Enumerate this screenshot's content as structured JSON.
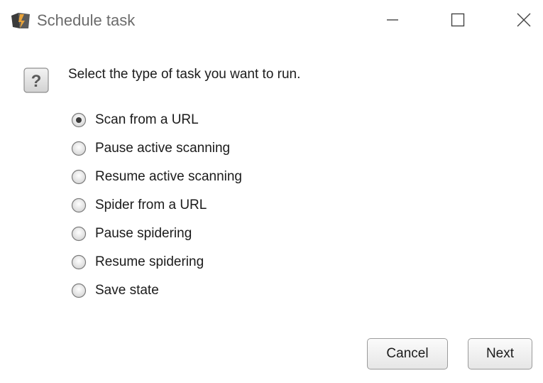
{
  "window": {
    "title": "Schedule task",
    "controls": [
      "minimize",
      "maximize",
      "close"
    ]
  },
  "prompt": "Select the type of task you want to run.",
  "options": [
    {
      "label": "Scan from a URL",
      "selected": true
    },
    {
      "label": "Pause active scanning",
      "selected": false
    },
    {
      "label": "Resume active scanning",
      "selected": false
    },
    {
      "label": "Spider from a URL",
      "selected": false
    },
    {
      "label": "Pause spidering",
      "selected": false
    },
    {
      "label": "Resume spidering",
      "selected": false
    },
    {
      "label": "Save state",
      "selected": false
    }
  ],
  "buttons": {
    "cancel": "Cancel",
    "next": "Next"
  },
  "icons": {
    "app": "burp-suite-icon",
    "help": "question-mark-icon"
  },
  "colors": {
    "title_text": "#6b6b6b",
    "body_text": "#1b1b1b",
    "radio_dot": "#3a3a3a"
  }
}
